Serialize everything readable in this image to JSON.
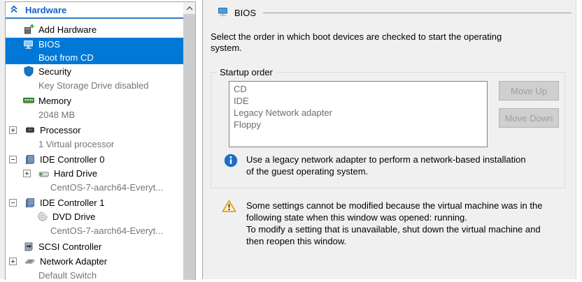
{
  "sidebar": {
    "header": "Hardware",
    "items": [
      {
        "label": "Add Hardware",
        "icon": "add-hardware-icon"
      },
      {
        "label": "BIOS",
        "sub": "Boot from CD",
        "icon": "bios-icon",
        "selected": true
      },
      {
        "label": "Security",
        "sub": "Key Storage Drive disabled",
        "icon": "security-shield-icon"
      },
      {
        "label": "Memory",
        "sub": "2048 MB",
        "icon": "memory-icon"
      },
      {
        "label": "Processor",
        "sub": "1 Virtual processor",
        "icon": "processor-icon",
        "expander": "plus"
      },
      {
        "label": "IDE Controller 0",
        "icon": "ide-controller-icon",
        "expander": "minus"
      },
      {
        "label": "Hard Drive",
        "sub": "CentOS-7-aarch64-Everyt...",
        "icon": "hard-drive-icon",
        "expander": "plus",
        "nested": true
      },
      {
        "label": "IDE Controller 1",
        "icon": "ide-controller-icon",
        "expander": "minus"
      },
      {
        "label": "DVD Drive",
        "sub": "CentOS-7-aarch64-Everyt...",
        "icon": "dvd-drive-icon",
        "nested": true
      },
      {
        "label": "SCSI Controller",
        "icon": "scsi-controller-icon"
      },
      {
        "label": "Network Adapter",
        "sub": "Default Switch",
        "icon": "network-adapter-icon",
        "expander": "plus"
      }
    ]
  },
  "main": {
    "title": "BIOS",
    "description_lines": [
      "Select the order in which boot devices are checked to start the operating",
      "system."
    ],
    "startup_group": {
      "label": "Startup order",
      "devices": [
        "CD",
        "IDE",
        "Legacy Network adapter",
        "Floppy"
      ],
      "move_up_label": "Move Up",
      "move_down_label": "Move Down",
      "info_lines": [
        "Use a legacy network adapter to perform a network-based installation",
        "of the guest operating system."
      ]
    },
    "warning_lines": [
      "Some settings cannot be modified because the virtual machine was in the",
      "following state when this window was opened: running.",
      "To modify a setting that is unavailable, shut down the virtual machine and",
      "then reopen this window."
    ]
  },
  "colors": {
    "selection_blue": "#0078d7",
    "header_blue": "#1061c4",
    "info_blue": "#1d6fc4",
    "warning_amber": "#e79f23",
    "panel_bg": "#f0f0f0"
  }
}
